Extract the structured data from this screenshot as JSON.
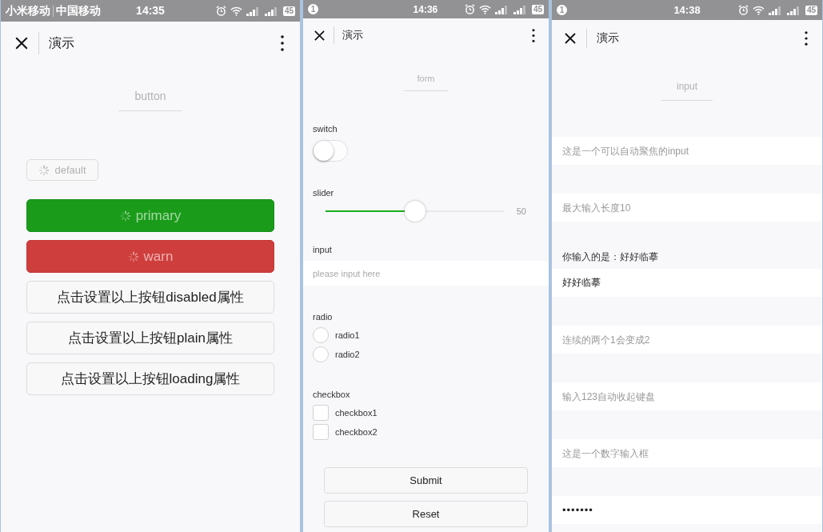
{
  "screens": [
    {
      "kind": "button",
      "status_bar": {
        "carriers": [
          "小米移动",
          "中国移动"
        ],
        "time": "14:35",
        "battery": "45"
      },
      "nav": {
        "title": "演示"
      },
      "page_title": "button",
      "buttons": [
        {
          "label": "default",
          "kind": "default",
          "mini": true,
          "loading": true,
          "disabled": true
        },
        {
          "label": "primary",
          "kind": "primary",
          "mini": false,
          "loading": true,
          "disabled": false
        },
        {
          "label": "warn",
          "kind": "warn",
          "mini": false,
          "loading": true,
          "disabled": false
        },
        {
          "label": "点击设置以上按钮disabled属性",
          "kind": "default",
          "mini": false,
          "loading": false,
          "disabled": false
        },
        {
          "label": "点击设置以上按钮plain属性",
          "kind": "default",
          "mini": false,
          "loading": false,
          "disabled": false
        },
        {
          "label": "点击设置以上按钮loading属性",
          "kind": "default",
          "mini": false,
          "loading": false,
          "disabled": false
        }
      ]
    },
    {
      "kind": "form",
      "status_bar": {
        "notification": "1",
        "time": "14:36",
        "battery": "45"
      },
      "nav": {
        "title": "演示"
      },
      "page_title": "form",
      "items": [
        {
          "kind": "switch",
          "label": "switch",
          "on": false
        },
        {
          "kind": "slider",
          "label": "slider",
          "level": 0.5,
          "reading": "50"
        },
        {
          "kind": "input",
          "label": "input",
          "placeholder": "please input here"
        },
        {
          "kind": "radio",
          "label": "radio",
          "options": [
            {
              "label": "radio1",
              "selected": false
            },
            {
              "label": "radio2",
              "selected": false
            }
          ]
        },
        {
          "kind": "checkbox",
          "label": "checkbox",
          "options": [
            {
              "label": "checkbox1",
              "checked": false
            },
            {
              "label": "checkbox2",
              "checked": false
            }
          ]
        }
      ],
      "buttons": [
        "Submit",
        "Reset"
      ]
    },
    {
      "kind": "input",
      "status_bar": {
        "notification": "1",
        "time": "14:38",
        "battery": "45"
      },
      "nav": {
        "title": "演示"
      },
      "page_title": "input",
      "rows": [
        {
          "kind": "field",
          "placeholder": "这是一个可以自动聚焦的input"
        },
        {
          "kind": "field",
          "placeholder": "最大输入长度10"
        },
        {
          "kind": "text",
          "text": "你输入的是：好好临摹"
        },
        {
          "kind": "field",
          "value": "好好临摹"
        },
        {
          "kind": "field",
          "placeholder": "连续的两个1会变成2"
        },
        {
          "kind": "field",
          "placeholder": "输入123自动收起键盘"
        },
        {
          "kind": "field",
          "placeholder": "这是一个数字输入框"
        },
        {
          "kind": "field",
          "value": "•••••••",
          "password": true
        }
      ]
    }
  ]
}
